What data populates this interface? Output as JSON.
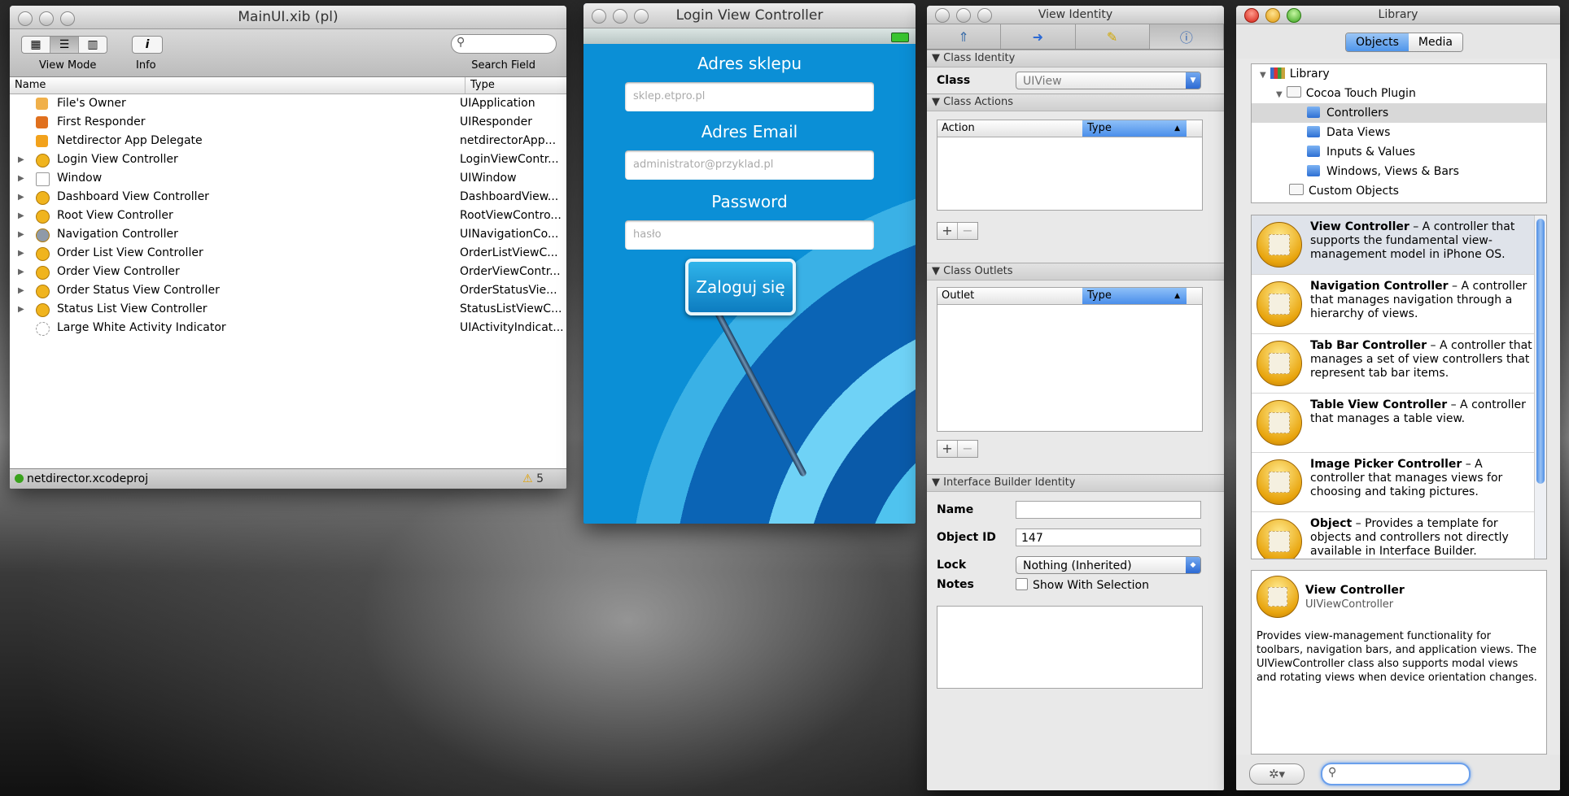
{
  "doc_window": {
    "title": "MainUI.xib (pl)",
    "toolbar": {
      "view_mode_label": "View Mode",
      "info_label": "Info",
      "info_glyph": "i",
      "search_label": "Search Field",
      "search_value": ""
    },
    "columns": {
      "name": "Name",
      "type": "Type"
    },
    "rows": [
      {
        "name": "File's Owner",
        "type": "UIApplication",
        "icon": "cube-icon",
        "color": "#f0b04a",
        "expandable": false
      },
      {
        "name": "First Responder",
        "type": "UIResponder",
        "icon": "responder-icon",
        "color": "#e0701e",
        "expandable": false
      },
      {
        "name": "Netdirector App Delegate",
        "type": "netdirectorApp...",
        "icon": "cube-icon",
        "color": "#f2a21c",
        "expandable": false
      },
      {
        "name": "Login View Controller",
        "type": "LoginViewContr...",
        "icon": "controller-icon",
        "color": "#f0b41e",
        "expandable": true
      },
      {
        "name": "Window",
        "type": "UIWindow",
        "icon": "window-icon",
        "color": "#ffffff",
        "expandable": true
      },
      {
        "name": "Dashboard View Controller",
        "type": "DashboardView...",
        "icon": "controller-icon",
        "color": "#f0b41e",
        "expandable": true
      },
      {
        "name": "Root View Controller",
        "type": "RootViewContro...",
        "icon": "controller-icon",
        "color": "#f0b41e",
        "expandable": true
      },
      {
        "name": "Navigation Controller",
        "type": "UINavigationCo...",
        "icon": "navigation-icon",
        "color": "#8f9aa8",
        "expandable": true
      },
      {
        "name": "Order List View Controller",
        "type": "OrderListViewC...",
        "icon": "controller-icon",
        "color": "#f0b41e",
        "expandable": true
      },
      {
        "name": "Order View Controller",
        "type": "OrderViewContr...",
        "icon": "controller-icon",
        "color": "#f0b41e",
        "expandable": true
      },
      {
        "name": "Order Status View Controller",
        "type": "OrderStatusVie...",
        "icon": "controller-icon",
        "color": "#f0b41e",
        "expandable": true
      },
      {
        "name": "Status List View Controller",
        "type": "StatusListViewC...",
        "icon": "controller-icon",
        "color": "#f0b41e",
        "expandable": true
      },
      {
        "name": "Large White Activity Indicator",
        "type": "UIActivityIndicat...",
        "icon": "activity-indicator-icon",
        "color": "#d8d8d8",
        "expandable": false
      }
    ],
    "status": {
      "project": "netdirector.xcodeproj",
      "warnings": "5"
    }
  },
  "login_window": {
    "title": "Login View Controller",
    "shop_label": "Adres sklepu",
    "shop_placeholder": "sklep.etpro.pl",
    "email_label": "Adres Email",
    "email_placeholder": "administrator@przyklad.pl",
    "password_label": "Password",
    "password_placeholder": "hasło",
    "login_button": "Zaloguj się"
  },
  "inspector": {
    "title": "View Identity",
    "class_identity": {
      "header": "Class Identity",
      "class_label": "Class",
      "class_value": "UIView"
    },
    "class_actions": {
      "header": "Class Actions",
      "col_action": "Action",
      "col_type": "Type"
    },
    "class_outlets": {
      "header": "Class Outlets",
      "col_outlet": "Outlet",
      "col_type": "Type"
    },
    "ib_identity": {
      "header": "Interface Builder Identity",
      "name_label": "Name",
      "name_value": "",
      "object_id_label": "Object ID",
      "object_id_value": "147",
      "lock_label": "Lock",
      "lock_value": "Nothing (Inherited)",
      "notes_label": "Notes",
      "show_with_selection": "Show With Selection"
    }
  },
  "library": {
    "title": "Library",
    "tabs": [
      "Objects",
      "Media"
    ],
    "tree": {
      "library": "Library",
      "cocoa_touch": "Cocoa Touch Plugin",
      "controllers": "Controllers",
      "data_views": "Data Views",
      "inputs_values": "Inputs & Values",
      "windows_views_bars": "Windows, Views & Bars",
      "custom_objects": "Custom Objects"
    },
    "items": [
      {
        "name": "View Controller",
        "desc": " – A controller that supports the fundamental view-management model in iPhone OS."
      },
      {
        "name": "Navigation Controller",
        "desc": " – A controller that manages navigation through a hierarchy of views."
      },
      {
        "name": "Tab Bar Controller",
        "desc": " – A controller that manages a set of view controllers that represent tab bar items."
      },
      {
        "name": "Table View Controller",
        "desc": " – A controller that manages a table view."
      },
      {
        "name": "Image Picker Controller",
        "desc": " – A controller that manages views for choosing and taking pictures."
      },
      {
        "name": "Object",
        "desc": " – Provides a template for objects and controllers not directly available in Interface Builder."
      }
    ],
    "detail": {
      "name": "View Controller",
      "class": "UIViewController",
      "description": "Provides view-management functionality for toolbars, navigation bars, and application views. The UIViewController class also supports modal views and rotating views when device orientation changes."
    },
    "search_value": ""
  }
}
